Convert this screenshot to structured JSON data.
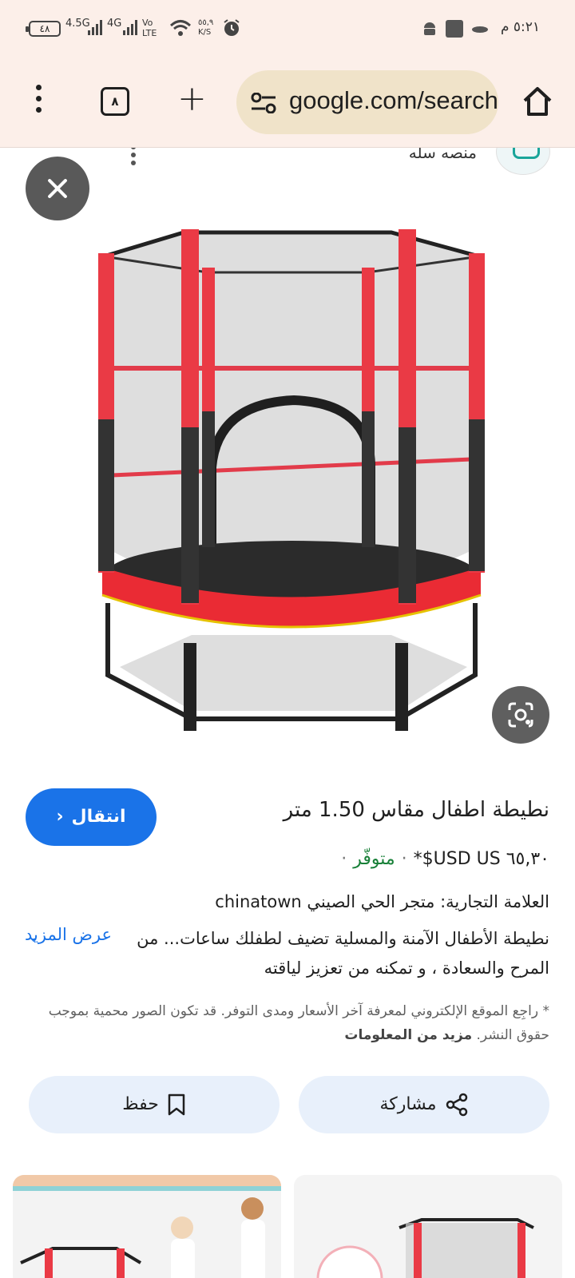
{
  "status_bar": {
    "battery": "٤٨",
    "network_1": "4.5G",
    "network_2": "4G",
    "volte": "Vo LTE",
    "speed": "٥٥,٩ K/S",
    "time": "٥:٢١ م"
  },
  "toolbar": {
    "tab_count": "٨",
    "url": "google.com/search"
  },
  "source": {
    "name": "منصه سله"
  },
  "product": {
    "title": "نطيطة اطفال مقاس 1.50 متر",
    "price": "٦٥,٣٠ USD US$*",
    "availability": "متوفّر",
    "brand": "العلامة التجارية: متجر الحي الصيني chinatown",
    "description": "نطيطة الأطفال الآمنة والمسلية تضيف لطفلك ساعات... من المرح والسعادة ، و تمكنه من تعزيز لياقته",
    "show_more": "عرض المزيد",
    "disclaimer": "* راجِع الموقع الإلكتروني لمعرفة آخر الأسعار ومدى التوفر. قد تكون الصور محمية بموجب حقوق النشر.",
    "learn_more": "مزيد من المعلومات"
  },
  "buttons": {
    "visit": "انتقال",
    "share": "مشاركة",
    "save": "حفظ"
  },
  "colors": {
    "accent": "#1a73e8",
    "available": "#188038",
    "chrome_bg": "#fcefe9",
    "omnibox_bg": "#f0e3c9",
    "button_tint": "#e8f0fb"
  },
  "icons": [
    "menu-dots-icon",
    "tab-switcher-icon",
    "plus-icon",
    "tune-icon",
    "home-icon",
    "close-icon",
    "google-lens-icon",
    "chevron-left-icon",
    "share-icon",
    "bookmark-icon",
    "chevron-down-icon"
  ]
}
